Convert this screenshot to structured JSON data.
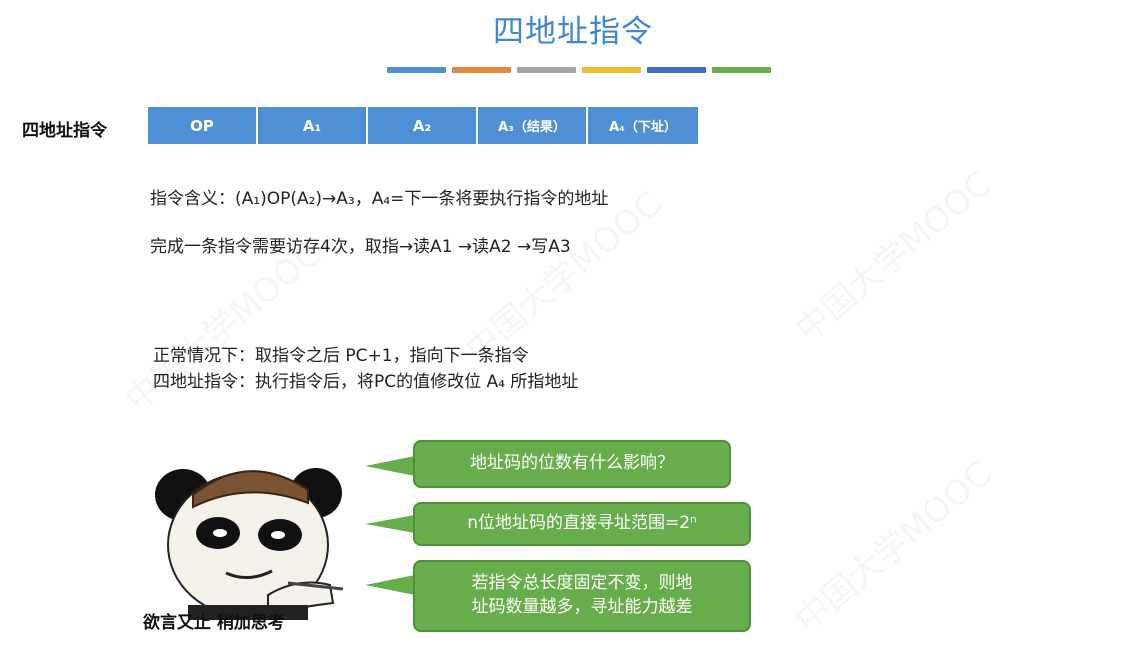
{
  "title": "四地址指令",
  "title_bar_colors": [
    "#4f8fd6",
    "#e08a3a",
    "#a5a5a5",
    "#f2bb2e",
    "#3e6cc0",
    "#6aad46"
  ],
  "row_label": "四地址指令",
  "format_fields": [
    {
      "label": "OP"
    },
    {
      "label": "A₁"
    },
    {
      "label": "A₂"
    },
    {
      "label": "A₃（结果）"
    },
    {
      "label": "A₄（下址）"
    }
  ],
  "meaning": "指令含义：(A₁)OP(A₂)→A₃，A₄=下一条将要执行指令的地址",
  "access": "完成一条指令需要访存4次，取指→读A1 →读A2 →写A3",
  "normal": "正常情况下：取指令之后 PC+1，指向下一条指令",
  "four_addr": "四地址指令：执行指令后，将PC的值修改位 A₄ 所指地址",
  "meme_caption": "欲言又止 稍加思考",
  "bubbles": {
    "b1": "地址码的位数有什么影响？",
    "b2": "n位地址码的直接寻址范围=2ⁿ",
    "b3_line1": "若指令总长度固定不变，则地",
    "b3_line2": "址码数量越多，寻址能力越差"
  },
  "watermark": "中国大学MOOC",
  "colors": {
    "accent": "#3d87d6",
    "field_bg": "#4f8fd6",
    "bubble": "#67ad4c"
  }
}
